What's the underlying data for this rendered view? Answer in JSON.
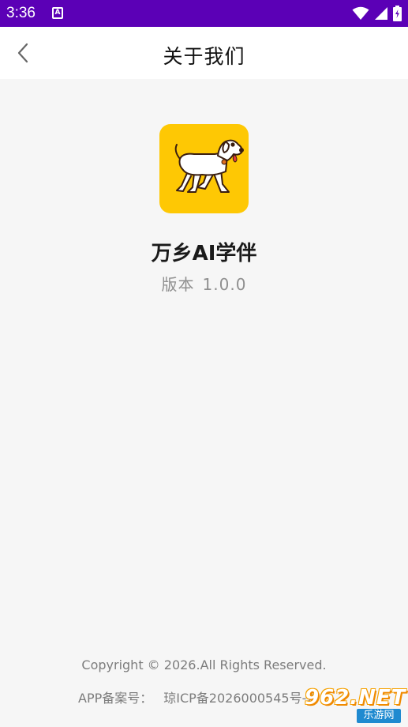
{
  "status_bar": {
    "time": "3:36",
    "notification_badge": "A",
    "background_color": "#5b00b6"
  },
  "header": {
    "title": "关于我们",
    "back_icon": "chevron-left-icon"
  },
  "app": {
    "icon": "dog-logo-icon",
    "name": "万乡AI学伴",
    "version_label": "版本",
    "version_value": "1.0.0"
  },
  "footer": {
    "copyright": "Copyright © 2026.All Rights Reserved.",
    "icp_label": "APP备案号：",
    "icp_value": "琼ICP备2026000545号-2"
  },
  "watermark": {
    "top": "962.NET",
    "bottom": "乐游网"
  }
}
